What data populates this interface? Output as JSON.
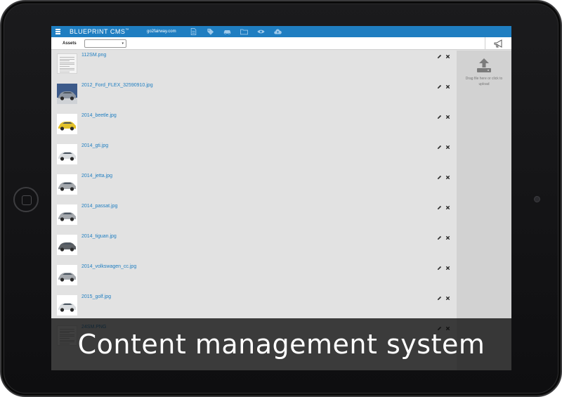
{
  "app": {
    "brand": "BLUEPRINT CMS",
    "brand_mark": "™",
    "site_link": "go2fairway.com",
    "nav_icons": [
      "document-icon",
      "tag-icon",
      "car-icon",
      "folder-icon",
      "eye-icon",
      "cloud-upload-icon"
    ]
  },
  "toolbar": {
    "section_label": "Assets",
    "select_value": "",
    "select_arrow": "▾"
  },
  "files": [
    {
      "name": "112SM.png",
      "thumb": "doc"
    },
    {
      "name": "2012_Ford_FLEX_32590910.jpg",
      "thumb": "car-blue"
    },
    {
      "name": "2014_beetle.jpg",
      "thumb": "car-yellow"
    },
    {
      "name": "2014_gti.jpg",
      "thumb": "car-white"
    },
    {
      "name": "2014_jetta.jpg",
      "thumb": "car-silver"
    },
    {
      "name": "2014_passat.jpg",
      "thumb": "car-silver"
    },
    {
      "name": "2014_tiguan.jpg",
      "thumb": "car-dark"
    },
    {
      "name": "2014_volkswagen_cc.jpg",
      "thumb": "car-silver"
    },
    {
      "name": "2015_golf.jpg",
      "thumb": "car-white"
    },
    {
      "name": "24SM.PNG",
      "thumb": "doc"
    }
  ],
  "upload": {
    "hint": "Drag file here or click to upload"
  },
  "caption": {
    "text": "Content management system"
  },
  "colors": {
    "header_blue": "#1f7ec1",
    "link_blue": "#1f7ec1",
    "list_bg": "#e2e2e2",
    "panel_bg": "#d2d2d2"
  }
}
